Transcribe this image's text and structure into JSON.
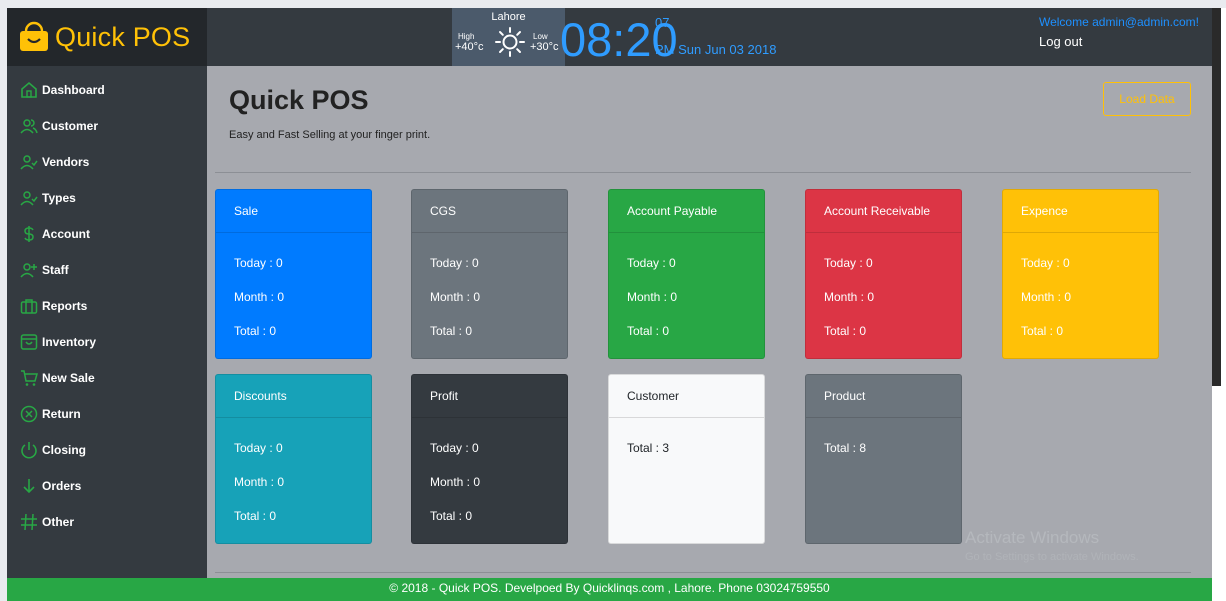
{
  "brand": {
    "name": "Quick POS",
    "color": "#ffc107"
  },
  "weather": {
    "city": "Lahore",
    "high_label": "High",
    "high_value": "+40°c",
    "low_label": "Low",
    "low_value": "+30°c"
  },
  "clock": {
    "time": "08:20",
    "seconds": "07",
    "date": "PM Sun Jun 03 2018"
  },
  "user": {
    "welcome": "Welcome admin@admin.com!",
    "logout_label": "Log out"
  },
  "sidebar": {
    "items": [
      {
        "label": "Dashboard",
        "icon": "home-icon"
      },
      {
        "label": "Customer",
        "icon": "users-icon"
      },
      {
        "label": "Vendors",
        "icon": "user-check-icon"
      },
      {
        "label": "Types",
        "icon": "user-check-icon"
      },
      {
        "label": "Account",
        "icon": "dollar-icon"
      },
      {
        "label": "Staff",
        "icon": "user-plus-icon"
      },
      {
        "label": "Reports",
        "icon": "briefcase-icon"
      },
      {
        "label": "Inventory",
        "icon": "shopping-bag-icon"
      },
      {
        "label": "New Sale",
        "icon": "cart-icon"
      },
      {
        "label": "Return",
        "icon": "x-circle-icon"
      },
      {
        "label": "Closing",
        "icon": "power-icon"
      },
      {
        "label": "Orders",
        "icon": "arrow-down-icon"
      },
      {
        "label": "Other",
        "icon": "hash-icon"
      }
    ]
  },
  "main": {
    "title": "Quick POS",
    "subtitle": "Easy and Fast Selling at your finger print.",
    "load_button": "Load Data",
    "cards": [
      {
        "title": "Sale",
        "lines": [
          "Today : 0",
          "Month : 0",
          "Total : 0"
        ],
        "bg": "#007bff",
        "fg": "#ffffff"
      },
      {
        "title": "CGS",
        "lines": [
          "Today : 0",
          "Month : 0",
          "Total : 0"
        ],
        "bg": "#6c757d",
        "fg": "#ffffff"
      },
      {
        "title": "Account Payable",
        "lines": [
          "Today : 0",
          "Month : 0",
          "Total : 0"
        ],
        "bg": "#28a745",
        "fg": "#ffffff"
      },
      {
        "title": "Account Receivable",
        "lines": [
          "Today : 0",
          "Month : 0",
          "Total : 0"
        ],
        "bg": "#dc3545",
        "fg": "#ffffff"
      },
      {
        "title": "Expence",
        "lines": [
          "Today : 0",
          "Month : 0",
          "Total : 0"
        ],
        "bg": "#ffc107",
        "fg": "#ffffff"
      },
      {
        "title": "Discounts",
        "lines": [
          "Today : 0",
          "Month : 0",
          "Total : 0"
        ],
        "bg": "#17a2b8",
        "fg": "#ffffff"
      },
      {
        "title": "Profit",
        "lines": [
          "Today : 0",
          "Month : 0",
          "Total : 0"
        ],
        "bg": "#343a40",
        "fg": "#ffffff"
      },
      {
        "title": "Customer",
        "lines": [
          "Total : 3"
        ],
        "bg": "#f8f9fa",
        "fg": "#212529"
      },
      {
        "title": "Product",
        "lines": [
          "Total : 8"
        ],
        "bg": "#6c757d",
        "fg": "#ffffff"
      }
    ]
  },
  "footer": {
    "text": "© 2018 - Quick POS. Develpoed By Quicklinqs.com , Lahore. Phone 03024759550"
  },
  "watermark": {
    "line1": "Activate Windows",
    "line2": "Go to Settings to activate Windows."
  }
}
